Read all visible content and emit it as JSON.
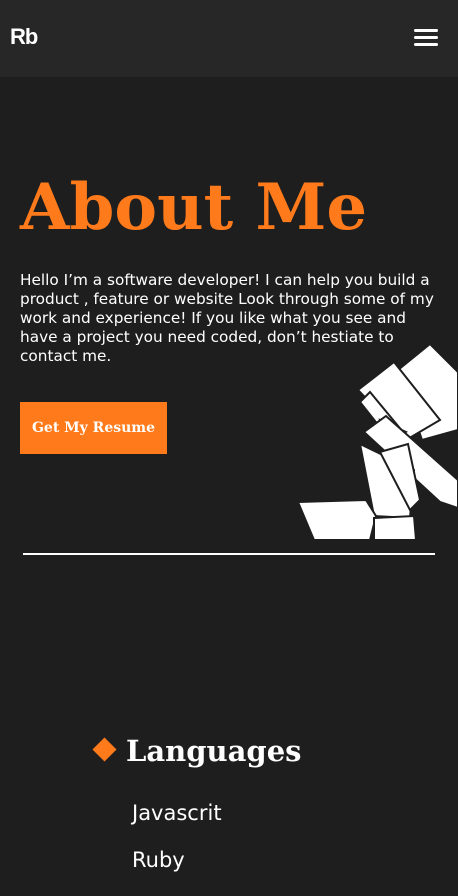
{
  "navbar": {
    "logo": "Rb",
    "menu_icon": "hamburger-menu-icon"
  },
  "about": {
    "title": "About Me",
    "text": "Hello I’m a software developer! I can help you build a product , feature or website Look through some of my work and experience! If you like what you see and have a project you need coded, don’t hestiate to contact me.",
    "resume_button": "Get My Resume",
    "decoration": "stacked-books-illustration"
  },
  "languages": {
    "icon": "orange-diamond-icon",
    "title": "Languages",
    "items": [
      "Javascrit",
      "Ruby"
    ]
  },
  "colors": {
    "accent": "#ff7a1a",
    "background": "#1e1e1e",
    "navbar": "#272727",
    "text": "#ffffff"
  }
}
